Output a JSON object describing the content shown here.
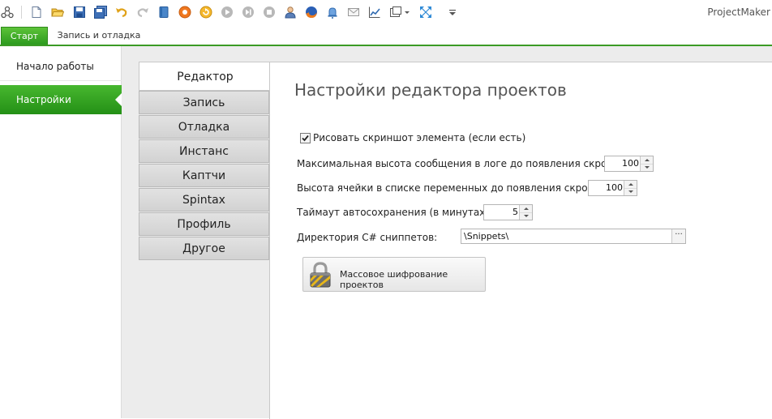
{
  "app_title": "ProjectMaker",
  "toolbar": {
    "icons": [
      "connections-icon",
      "new-file-icon",
      "open-folder-icon",
      "save-icon",
      "save-all-icon",
      "undo-icon",
      "redo-icon",
      "notebook-icon",
      "record-icon",
      "refresh-icon",
      "play-icon",
      "step-icon",
      "stop-icon",
      "user-icon",
      "firefox-icon",
      "bell-icon",
      "mail-icon",
      "chart-icon",
      "window-icon",
      "fit-icon",
      "customize-icon"
    ]
  },
  "ribbon": {
    "tabs": [
      "Старт",
      "Запись и отладка"
    ]
  },
  "nav": {
    "items": [
      "Начало работы",
      "Настройки"
    ],
    "selected": "Настройки"
  },
  "settings_tabs": [
    "Редактор",
    "Запись",
    "Отладка",
    "Инстанс",
    "Каптчи",
    "Spintax",
    "Профиль",
    "Другое"
  ],
  "editor": {
    "title": "Настройки редактора проектов",
    "draw_screenshot": {
      "label": "Рисовать скриншот элемента (если есть)",
      "checked": true
    },
    "max_log_height": {
      "label": "Максимальная высота сообщения в логе до появления скролла",
      "value": "100"
    },
    "cell_height": {
      "label": "Высота ячейки в списке переменных до появления скролла",
      "value": "100"
    },
    "autosave": {
      "label": "Таймаут автосохранения (в минутах):",
      "value": "5"
    },
    "snippets_dir": {
      "label": "Директория C# сниппетов:",
      "value": "\\Snippets\\",
      "browse": "···"
    },
    "encrypt_button": "Массовое шифрование проектов"
  },
  "colors": {
    "accent_green": "#2d9a1f",
    "panel_bg": "#ececec"
  }
}
